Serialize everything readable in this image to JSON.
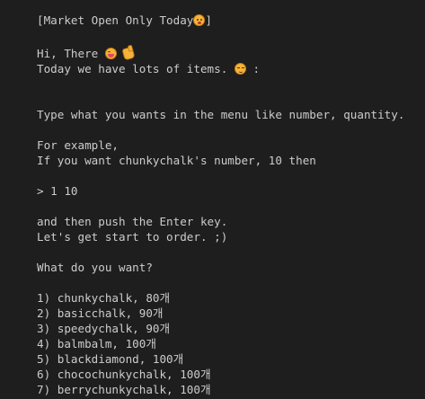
{
  "terminal": {
    "header_text": "[Market Open Only Today",
    "header_close": "]",
    "header_icon": "worried-face-emoji",
    "greeting_text": "Hi, There ",
    "greeting_icons": [
      "grinning-face-emoji",
      "waving-hand-emoji"
    ],
    "items_text": "Today we have lots of items. ",
    "items_icon": "relieved-face-emoji",
    "items_suffix": " :",
    "instruction": "Type what you wants in the menu like number, quantity.",
    "example_label": "For example,",
    "example_desc": "If you want chunkychalk's number, 10 then",
    "example_input": "> 1 10",
    "enter_text": "and then push the Enter key.",
    "start_text": "Let's get start to order. ;)",
    "question": "What do you want?",
    "menu": [
      "1) chunkychalk, 80개",
      "2) basicchalk, 90개",
      "3) speedychalk, 90개",
      "4) balmbalm, 100개",
      "5) blackdiamond, 100개",
      "6) chocochunkychalk, 100개",
      "7) berrychunkychalk, 100개"
    ]
  },
  "colors": {
    "background": "#1e1e1e",
    "text": "#cccccc",
    "emoji": "#f5b33a"
  }
}
